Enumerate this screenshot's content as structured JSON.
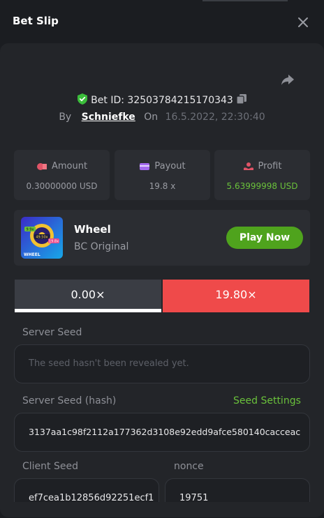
{
  "header": {
    "title": "Bet Slip"
  },
  "bet": {
    "id_label": "Bet ID: 32503784215170343",
    "by_label": "By",
    "user": "Schniefke",
    "on_label": "On",
    "date": "16.5.2022, 22:30:40"
  },
  "stats": {
    "amount": {
      "label": "Amount",
      "value": "0.30000000 USD"
    },
    "payout": {
      "label": "Payout",
      "value": "19.8 x"
    },
    "profit": {
      "label": "Profit",
      "value": "5.63999998 USD"
    }
  },
  "game": {
    "name": "Wheel",
    "subtitle": "BC Original",
    "play_label": "Play Now",
    "thumb_text": "WHEEL",
    "thumb_badges": [
      "9.9x",
      "49.50x",
      "19.8x"
    ]
  },
  "multipliers": [
    "0.00×",
    "19.80×"
  ],
  "seeds": {
    "server_label": "Server Seed",
    "server_placeholder": "The seed hasn't been revealed yet.",
    "hash_label": "Server Seed (hash)",
    "settings_link": "Seed Settings",
    "hash_value": "3137aa1c98f2112a177362d3108e92edd9afce580140cacceac",
    "client_label": "Client Seed",
    "client_value": "ef7cea1b12856d92251ecf1",
    "nonce_label": "nonce",
    "nonce_value": "19751"
  },
  "colors": {
    "accent_green": "#6ac13b",
    "button_green": "#4fa31d",
    "loss_red": "#ef4a4a"
  },
  "icons": [
    "close-icon",
    "share-icon",
    "shield-check-icon",
    "copy-icon",
    "amount-icon",
    "wallet-icon",
    "profit-icon"
  ]
}
